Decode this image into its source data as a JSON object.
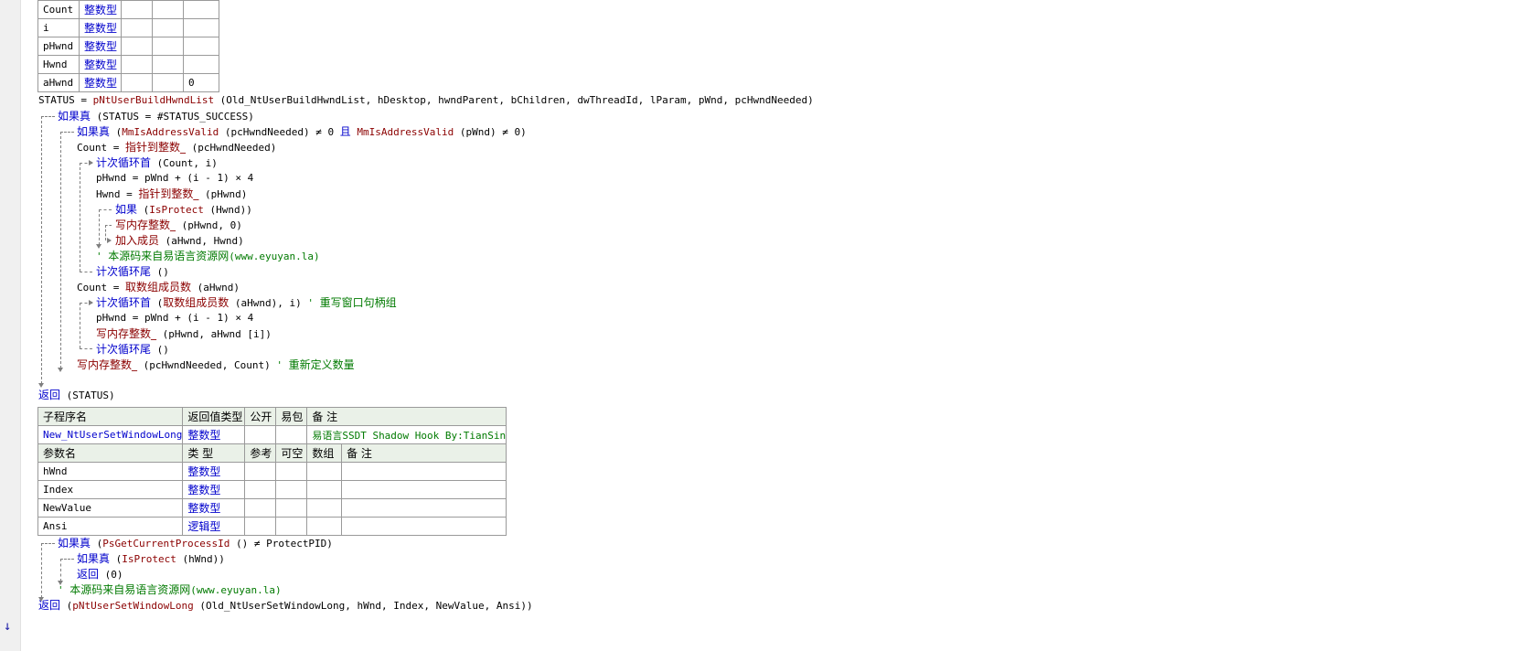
{
  "vars": [
    {
      "name": "Count",
      "type": "整数型",
      "init": ""
    },
    {
      "name": "i",
      "type": "整数型",
      "init": ""
    },
    {
      "name": "pHwnd",
      "type": "整数型",
      "init": ""
    },
    {
      "name": "Hwnd",
      "type": "整数型",
      "init": ""
    },
    {
      "name": "aHwnd",
      "type": "整数型",
      "init": "0"
    }
  ],
  "code1": {
    "status_lhs": "STATUS = ",
    "status_fn": "pNtUserBuildHwndList",
    "status_args": " (Old_NtUserBuildHwndList, hDesktop, hwndParent, bChildren, dwThreadId, lParam, pWnd, pcHwndNeeded)",
    "if1_kw": "如果真",
    "if1_cond": " (STATUS = #STATUS_SUCCESS)",
    "if2_kw": "如果真",
    "if2_f1": "MmIsAddressValid",
    "if2_mid": " (pcHwndNeeded) ≠ 0 ",
    "if2_and": "且",
    "if2_f2": "MmIsAddressValid",
    "if2_end": " (pWnd) ≠ 0)",
    "if2_open": " (",
    "cnt_lhs": "Count = ",
    "cnt_fn": "指针到整数_",
    "cnt_args": " (pcHwndNeeded)",
    "loop1_kw": "计次循环首",
    "loop1_args": " (Count, i)",
    "phwnd1": "pHwnd = pWnd + (i - 1) × 4",
    "hwnd_lhs": "Hwnd = ",
    "hwnd_fn": "指针到整数_",
    "hwnd_args": " (pHwnd)",
    "if3_kw": "如果",
    "if3_open": " (",
    "if3_fn": "IsProtect",
    "if3_args": " (Hwnd))",
    "write1_fn": "写内存整数_",
    "write1_args": " (pHwnd, 0)",
    "add_fn": "加入成员",
    "add_args": " (aHwnd, Hwnd)",
    "cm1_mark": "' ",
    "cm1_cn": "本源码来自易语言资源网",
    "cm1_url": "(www.eyuyan.la)",
    "loop1_end_kw": "计次循环尾",
    "loop1_end_args": " ()",
    "cnt2_lhs": "Count = ",
    "cnt2_fn": "取数组成员数",
    "cnt2_args": " (aHwnd)",
    "loop2_kw": "计次循环首",
    "loop2_open": " (",
    "loop2_fn": "取数组成员数",
    "loop2_args": " (aHwnd), i) ",
    "loop2_cm_mark": "' ",
    "loop2_cm": "重写窗口句柄组",
    "phwnd2": "pHwnd = pWnd + (i - 1) × 4",
    "write2_fn": "写内存整数_",
    "write2_args": " (pHwnd, aHwnd [i])",
    "loop2_end_kw": "计次循环尾",
    "loop2_end_args": " ()",
    "write3_fn": "写内存整数_",
    "write3_args": " (pcHwndNeeded, Count) ",
    "write3_cm_mark": "' ",
    "write3_cm": "重新定义数量",
    "ret_kw": "返回",
    "ret_args": " (STATUS)"
  },
  "sub": {
    "header": [
      "子程序名",
      "返回值类型",
      "公开",
      "易包",
      "备 注"
    ],
    "name": "New_NtUserSetWindowLong",
    "return_type": "整数型",
    "note": "易语言SSDT Shadow Hook By:TianSin",
    "param_header": [
      "参数名",
      "类 型",
      "参考",
      "可空",
      "数组",
      "备 注"
    ],
    "params": [
      {
        "name": "hWnd",
        "type": "整数型"
      },
      {
        "name": "Index",
        "type": "整数型"
      },
      {
        "name": "NewValue",
        "type": "整数型"
      },
      {
        "name": "Ansi",
        "type": "逻辑型"
      }
    ]
  },
  "code2": {
    "if1_kw": "如果真",
    "if1_open": " (",
    "if1_fn": "PsGetCurrentProcessId",
    "if1_rest": " () ≠ ProtectPID)",
    "if2_kw": "如果真",
    "if2_open": " (",
    "if2_fn": "IsProtect",
    "if2_args": " (hWnd))",
    "ret1_kw": "返回",
    "ret1_args": " (0)",
    "cm_mark": "' ",
    "cm_cn": "本源码来自易语言资源网",
    "cm_url": "(www.eyuyan.la)",
    "ret2_kw": "返回",
    "ret2_open": " (",
    "ret2_fn": "pNtUserSetWindowLong",
    "ret2_args": " (Old_NtUserSetWindowLong, hWnd, Index, NewValue, Ansi))"
  },
  "gutter_arrow": "↓"
}
